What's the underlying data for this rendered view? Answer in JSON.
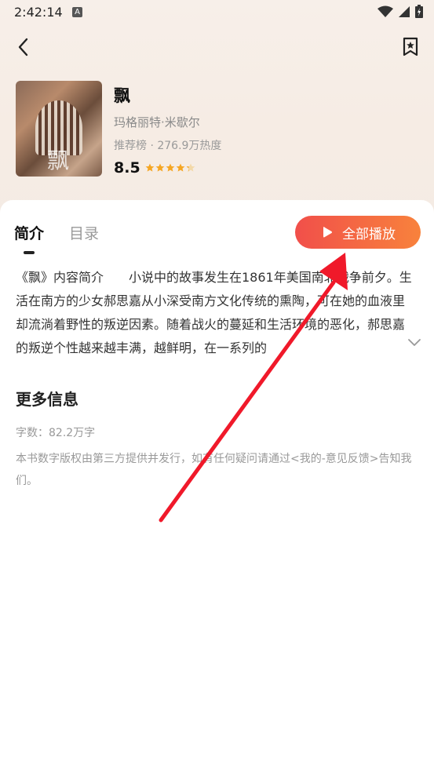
{
  "status_bar": {
    "time": "2:42:14",
    "notification_badge": "A"
  },
  "book": {
    "title": "飘",
    "author": "玛格丽特·米歇尔",
    "meta": "推荐榜 · 276.9万热度",
    "rating": "8.5",
    "stars_fraction": 0.85,
    "cover_title": "飘"
  },
  "tabs": [
    {
      "label": "简介"
    },
    {
      "label": "目录"
    }
  ],
  "play_all": {
    "label": "全部播放"
  },
  "intro": {
    "text": "《飘》内容简介　　小说中的故事发生在1861年美国南北战争前夕。生活在南方的少女郝思嘉从小深受南方文化传统的熏陶，可在她的血液里却流淌着野性的叛逆因素。随着战火的蔓延和生活环境的恶化，郝思嘉的叛逆个性越来越丰满，越鲜明，在一系列的"
  },
  "more_info": {
    "title": "更多信息",
    "word_count": "字数：82.2万字",
    "notice": "本书数字版权由第三方提供并发行，如有任何疑问请通过<我的-意见反馈>告知我们。"
  },
  "colors": {
    "accent_start": "#f14f4a",
    "accent_end": "#f8823c",
    "star": "#f5a623",
    "annotation_arrow": "#f0192a"
  }
}
